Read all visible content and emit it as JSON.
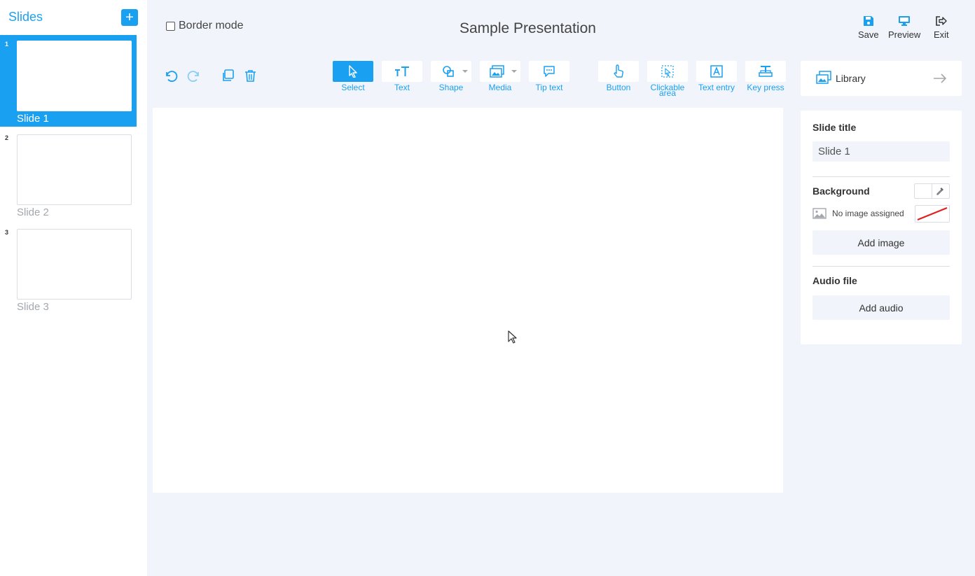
{
  "sidebar": {
    "title": "Slides",
    "add_label": "+",
    "slides": [
      {
        "num": "1",
        "label": "Slide 1",
        "active": true
      },
      {
        "num": "2",
        "label": "Slide 2",
        "active": false
      },
      {
        "num": "3",
        "label": "Slide 3",
        "active": false
      }
    ]
  },
  "header": {
    "border_mode_label": "Border mode",
    "presentation_title": "Sample Presentation",
    "actions": {
      "save": "Save",
      "preview": "Preview",
      "exit": "Exit"
    }
  },
  "toolbar": {
    "tools": {
      "select": "Select",
      "text": "Text",
      "shape": "Shape",
      "media": "Media",
      "tip_text": "Tip text",
      "button": "Button",
      "clickable_area": "Clickable area",
      "text_entry": "Text entry",
      "key_press": "Key press"
    }
  },
  "library": {
    "label": "Library"
  },
  "properties": {
    "slide_title_heading": "Slide title",
    "slide_title_value": "Slide 1",
    "background_heading": "Background",
    "no_image_text": "No image assigned",
    "add_image_label": "Add image",
    "audio_heading": "Audio file",
    "add_audio_label": "Add audio"
  },
  "colors": {
    "accent": "#1aa0f0",
    "background": "#f1f5fb",
    "panel": "#ffffff"
  }
}
